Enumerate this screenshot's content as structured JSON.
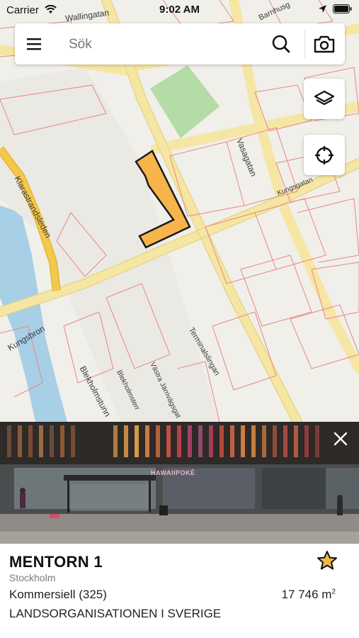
{
  "status_bar": {
    "carrier": "Carrier",
    "time": "9:02 AM"
  },
  "search": {
    "placeholder": "Sök"
  },
  "map": {
    "street_labels": {
      "wallingatan": "Wallingatan",
      "barnhusgatan": "Barnhusg",
      "vasagatan": "Vasagatan",
      "kungsgatan": "Kungsgatan",
      "klarastrandsleden": "Klarastrandsleden",
      "kungsbron": "Kungsbron",
      "terminalslingan": "Terminalslingan",
      "blekholmstunneln": "Blekholmstunn",
      "blekholmsterrassen": "Blekholmsterr",
      "vastra_jarnvagsgatan": "Västra Järnvägsgat"
    },
    "colors": {
      "parcel": "#f6b44b",
      "water": "#a7cfe6",
      "park": "#b5dba6",
      "roads": "#f5e6a3",
      "highway": "#f2c94c"
    }
  },
  "photo": {
    "storefront_sign": "HAWAIIPOKÉ"
  },
  "property": {
    "name": "MENTORN 1",
    "city": "Stockholm",
    "type": "Kommersiell (325)",
    "area_value": "17 746 m",
    "area_superscript": "2",
    "owner": "LANDSORGANISATIONEN I SVERIGE",
    "favorite_color": "#f6b44b"
  },
  "icons": [
    "wifi-icon",
    "location-arrow-icon",
    "battery-icon",
    "menu-icon",
    "search-icon",
    "camera-icon",
    "layers-icon",
    "locate-icon",
    "close-icon",
    "star-icon"
  ]
}
